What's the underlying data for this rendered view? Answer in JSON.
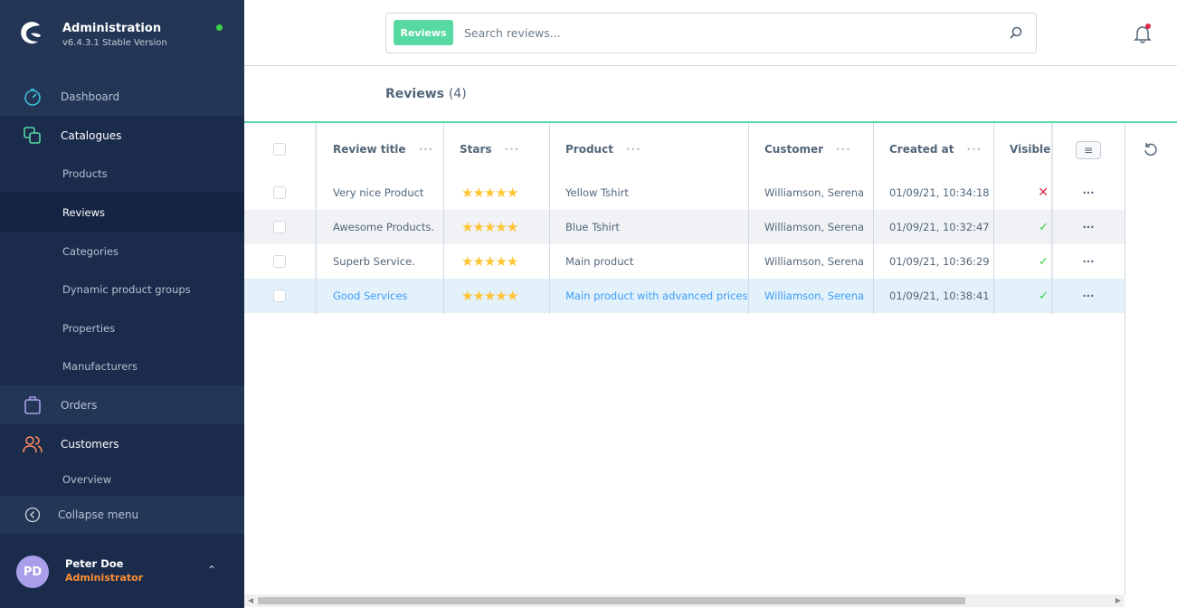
{
  "app": {
    "title": "Administration",
    "version": "v6.4.3.1 Stable Version"
  },
  "sidebar": {
    "items": [
      {
        "label": "Dashboard",
        "icon": "dashboard-icon"
      },
      {
        "label": "Catalogues",
        "icon": "catalogues-icon"
      },
      {
        "label": "Products"
      },
      {
        "label": "Reviews"
      },
      {
        "label": "Categories"
      },
      {
        "label": "Dynamic product groups"
      },
      {
        "label": "Properties"
      },
      {
        "label": "Manufacturers"
      },
      {
        "label": "Orders",
        "icon": "orders-icon"
      },
      {
        "label": "Customers",
        "icon": "customers-icon"
      },
      {
        "label": "Overview"
      }
    ],
    "collapse": "Collapse menu"
  },
  "user": {
    "initials": "PD",
    "name": "Peter Doe",
    "role": "Administrator"
  },
  "search": {
    "chip": "Reviews",
    "placeholder": "Search reviews..."
  },
  "page": {
    "title": "Reviews",
    "count": "(4)"
  },
  "table": {
    "columns": [
      "Review title",
      "Stars",
      "Product",
      "Customer",
      "Created at",
      "Visible"
    ],
    "rows": [
      {
        "title": "Very nice Product",
        "stars": 5,
        "product": "Yellow Tshirt",
        "customer": "Williamson, Serena",
        "created": "01/09/21, 10:34:18",
        "visible": false
      },
      {
        "title": "Awesome Products.",
        "stars": 5,
        "product": "Blue Tshirt",
        "customer": "Williamson, Serena",
        "created": "01/09/21, 10:32:47",
        "visible": true
      },
      {
        "title": "Superb Service.",
        "stars": 5,
        "product": "Main product",
        "customer": "Williamson, Serena",
        "created": "01/09/21, 10:36:29",
        "visible": true
      },
      {
        "title": "Good Services",
        "stars": 5,
        "product": "Main product with advanced prices",
        "customer": "Williamson, Serena",
        "created": "01/09/21, 10:38:41",
        "visible": true
      }
    ]
  },
  "colors": {
    "accent": "#57d9a3",
    "sidebar": "#1a2b4b",
    "link": "#3d9ef8",
    "star": "#ffc534",
    "visible_true": "#37d046",
    "visible_false": "#de294c"
  }
}
